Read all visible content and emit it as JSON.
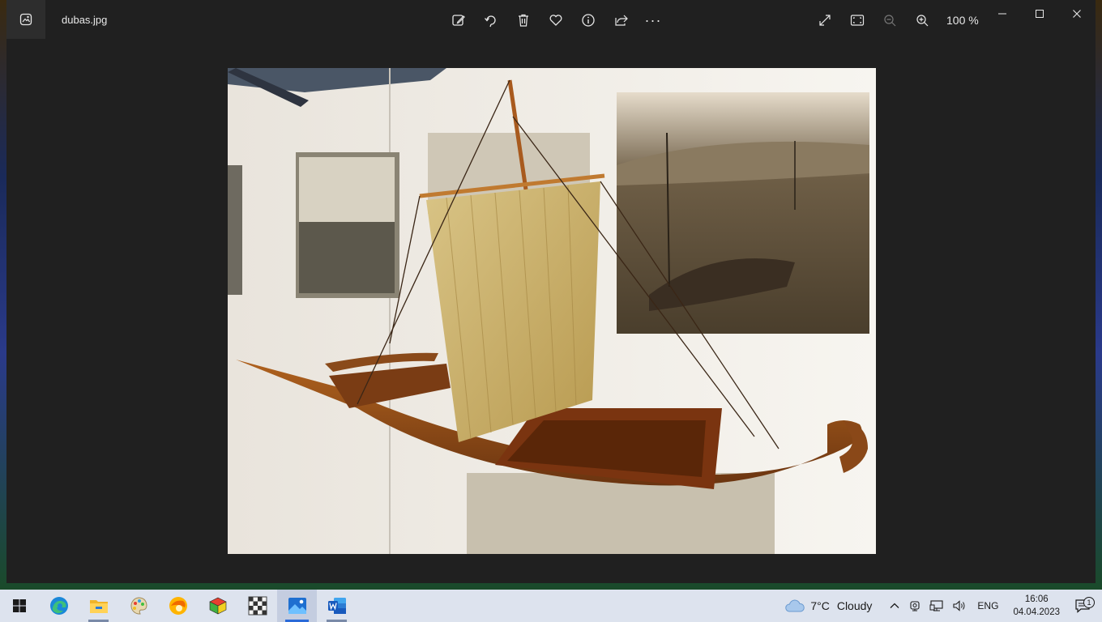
{
  "window": {
    "file_name": "dubas.jpg",
    "zoom_level": "100 %"
  },
  "toolbar": {
    "edit": "edit-icon",
    "rotate": "rotate-icon",
    "delete": "trash-icon",
    "favorite": "heart-icon",
    "info": "info-icon",
    "share": "share-icon",
    "more": "more-icon",
    "more_label": "···"
  },
  "view_tools": {
    "fullscreen": "expand-icon",
    "fit": "fit-window-icon",
    "zoom_out": "zoom-out-icon",
    "zoom_in": "zoom-in-icon"
  },
  "photo": {
    "alt": "Model of a wooden sailing river boat with a tan square sail in a museum display case, with old engravings on the wall behind"
  },
  "taskbar": {
    "apps": [
      {
        "name": "start",
        "icon": "windows-icon"
      },
      {
        "name": "edge",
        "icon": "edge-icon"
      },
      {
        "name": "file-explorer",
        "icon": "folder-icon"
      },
      {
        "name": "paint",
        "icon": "paint-icon"
      },
      {
        "name": "browser",
        "icon": "browser-icon"
      },
      {
        "name": "cube-app",
        "icon": "cube-icon"
      },
      {
        "name": "chess-app",
        "icon": "chess-icon"
      },
      {
        "name": "photos",
        "icon": "photos-icon"
      },
      {
        "name": "word",
        "icon": "word-icon"
      }
    ],
    "weather_temp": "7°C",
    "weather_text": "Cloudy",
    "language": "ENG",
    "time": "16:06",
    "date": "04.04.2023",
    "notifications_count": "1"
  },
  "colors": {
    "window_bg": "#202020",
    "taskbar_bg": "#dde3ee",
    "accent": "#2a6ad8"
  }
}
